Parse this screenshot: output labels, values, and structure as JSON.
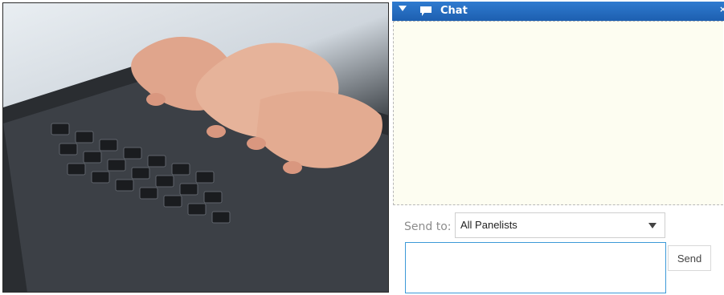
{
  "chat": {
    "title": "Chat",
    "close_label": "×",
    "send_to_label": "Send to:",
    "send_to_value": "All Panelists",
    "message_placeholder": "",
    "send_label": "Send"
  },
  "icons": {
    "collapse": "triangle-down-icon",
    "chat": "speech-bubble-icon",
    "close": "close-icon",
    "dropdown": "chevron-down-icon"
  },
  "colors": {
    "header": "#2f7bd0",
    "chat_body": "#fdfdf1",
    "input_border": "#3d9ad8"
  }
}
